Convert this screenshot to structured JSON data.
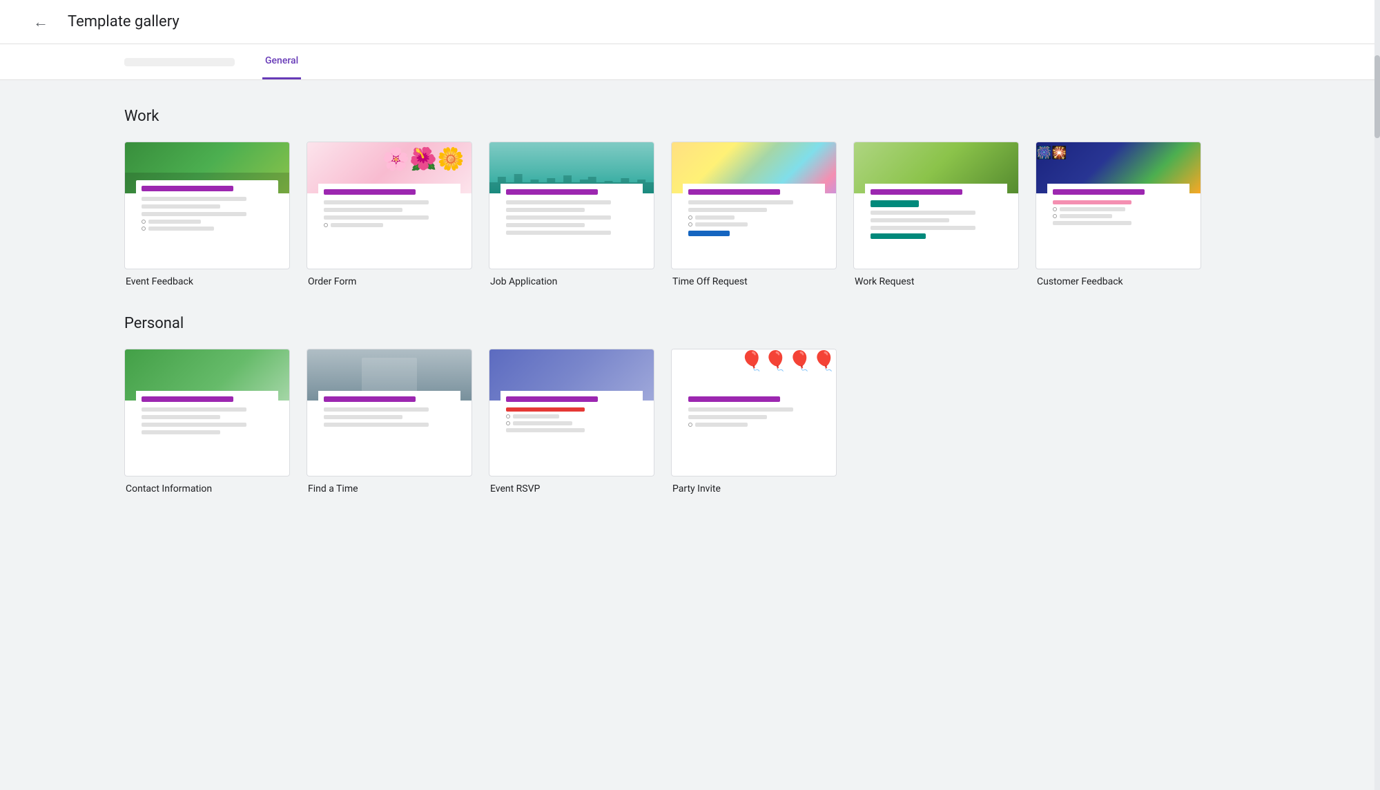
{
  "header": {
    "back_label": "←",
    "title": "Template gallery"
  },
  "tabs": {
    "blurred_tab": "...",
    "general_tab": "General"
  },
  "work_section": {
    "title": "Work",
    "templates": [
      {
        "label": "Event Feedback",
        "key": "event-feedback"
      },
      {
        "label": "Order Form",
        "key": "order-form"
      },
      {
        "label": "Job Application",
        "key": "job-application"
      },
      {
        "label": "Time Off Request",
        "key": "time-off-request"
      },
      {
        "label": "Work Request",
        "key": "work-request"
      },
      {
        "label": "Customer Feedback",
        "key": "customer-feedback"
      }
    ]
  },
  "personal_section": {
    "title": "Personal",
    "templates": [
      {
        "label": "Contact Information",
        "key": "contact-info"
      },
      {
        "label": "Find a Time",
        "key": "find-time"
      },
      {
        "label": "Event RSVP",
        "key": "event-rsvp"
      },
      {
        "label": "Party Invite",
        "key": "party-invite"
      }
    ]
  }
}
